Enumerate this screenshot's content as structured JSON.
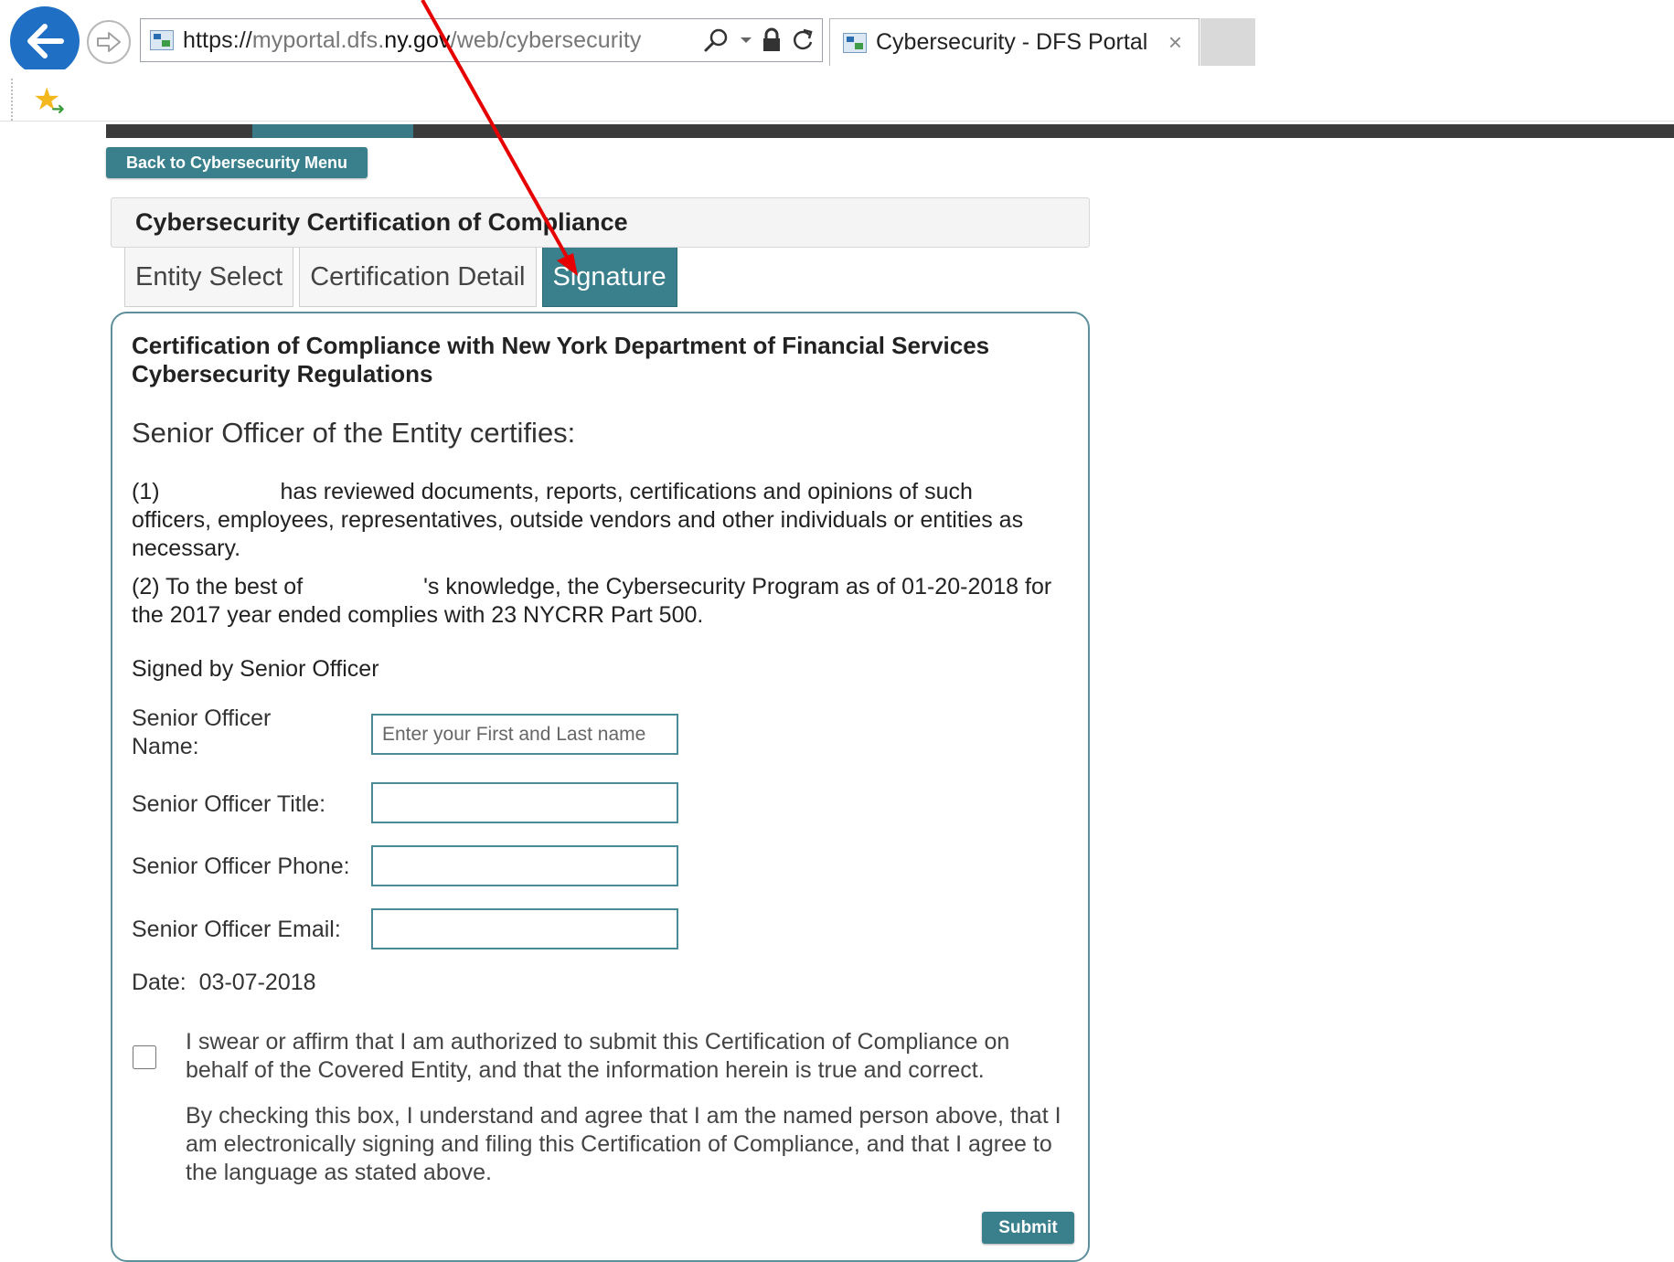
{
  "browser": {
    "url_scheme": "https://",
    "url_sub": "myportal.dfs.",
    "url_domain": "ny.gov",
    "url_path": "/web/cybersecurity",
    "tab_title": "Cybersecurity - DFS Portal",
    "tab_close": "×"
  },
  "nav": {
    "back_to_menu": "Back to Cybersecurity Menu"
  },
  "form": {
    "header_title": "Cybersecurity Certification of Compliance",
    "tabs": [
      {
        "label": "Entity Select"
      },
      {
        "label": "Certification Detail"
      },
      {
        "label": "Signature"
      }
    ],
    "cert_title": "Certification of Compliance with New York Department of Financial Services Cybersecurity Regulations",
    "certifies": "Senior Officer of the Entity certifies:",
    "para1": "(1)                   has reviewed documents, reports, certifications and opinions of such officers, employees, representatives, outside vendors and other individuals or entities as necessary.",
    "para2": "(2) To the best of                   's knowledge, the Cybersecurity Program as of 01-20-2018 for the 2017 year ended complies with 23 NYCRR Part 500.",
    "signed_by": "Signed by Senior Officer",
    "fields": {
      "name_label": "Senior Officer Name:",
      "name_placeholder": "Enter your First and Last name",
      "title_label": "Senior Officer Title:",
      "phone_label": "Senior Officer Phone:",
      "email_label": "Senior Officer Email:"
    },
    "date": "Date:  03-07-2018",
    "affirm1": "I swear or affirm that I am authorized to submit this Certification of Compliance on behalf of the Covered Entity, and that the information herein is true and correct.",
    "affirm2": "By checking this box, I understand and agree that I am the named person above, that I am electronically signing and filing this Certification of Compliance, and that I agree to the language as stated above.",
    "submit": "Submit"
  },
  "colors": {
    "accent": "#3a7f8c",
    "annotation": "#e60000"
  },
  "icons": {
    "back": "back-arrow-icon",
    "forward": "forward-arrow-icon",
    "search": "search-icon",
    "lock": "lock-icon",
    "refresh": "refresh-icon",
    "favorites": "favorites-star-icon"
  }
}
